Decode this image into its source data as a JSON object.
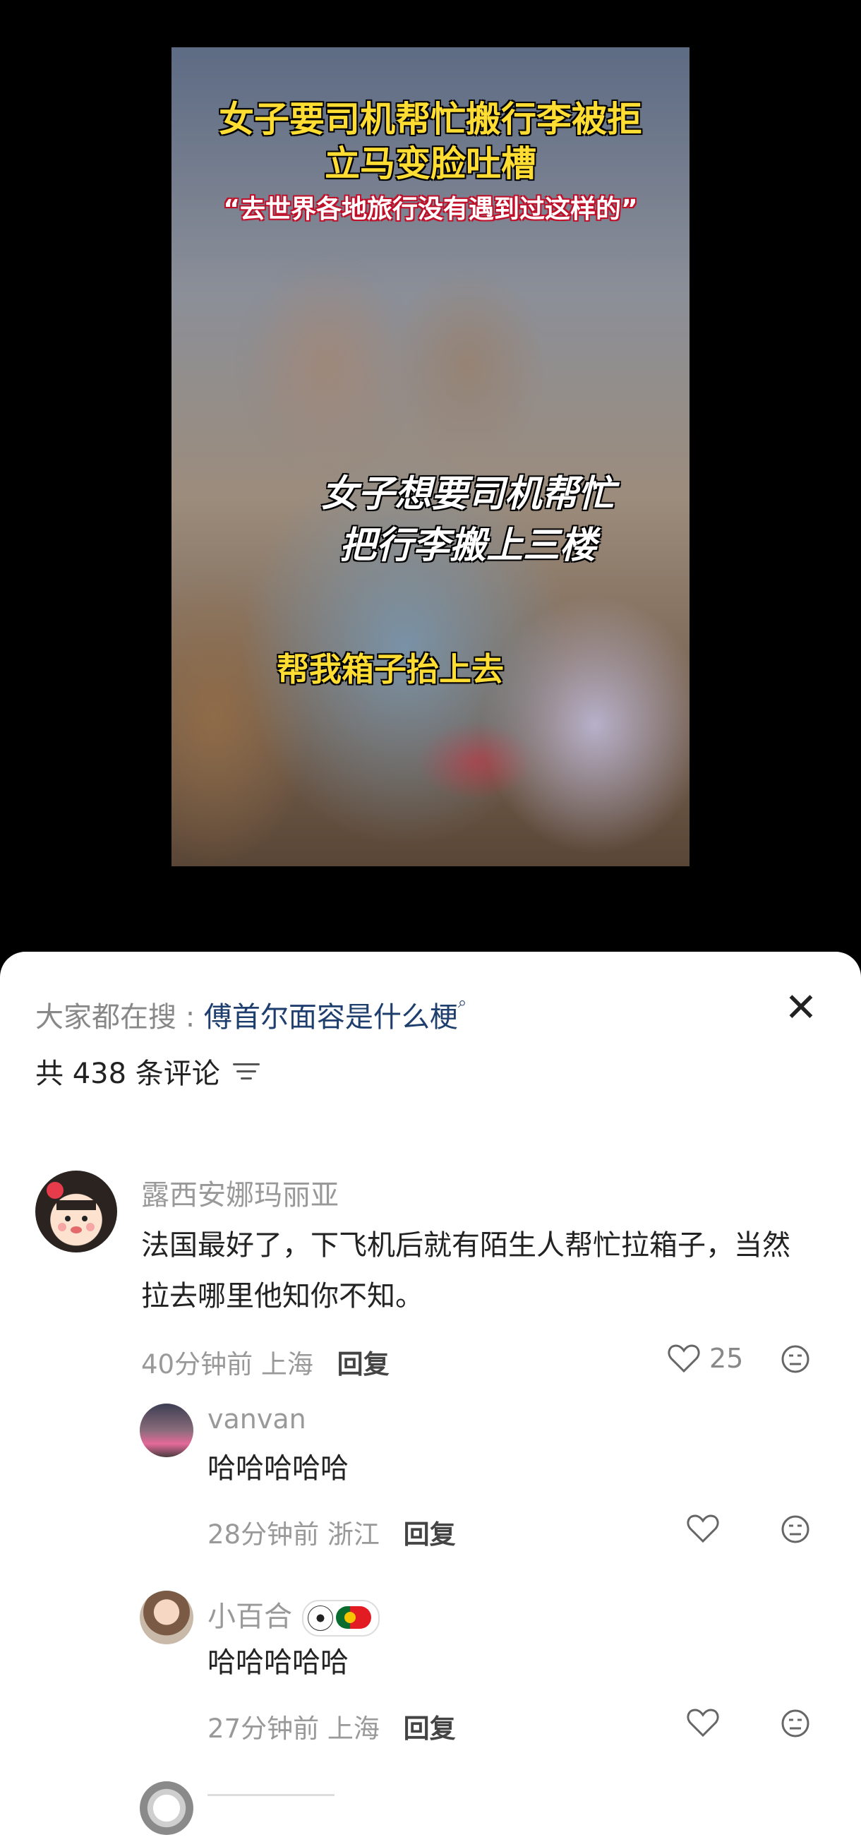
{
  "video": {
    "title_line1": "女子要司机帮忙搬行李被拒",
    "title_line2": "立马变脸吐槽",
    "quote": "“去世界各地旅行没有遇到过这样的”",
    "subtitle_line1": "女子想要司机帮忙",
    "subtitle_line2": "把行李搬上三楼",
    "dialogue": "帮我箱子抬上去"
  },
  "comments_sheet": {
    "search_prefix": "大家都在搜 :",
    "search_term": "傅首尔面容是什么梗",
    "total_label": "共 438 条评论",
    "icons": {
      "close": "close-icon",
      "sort": "filter-icon"
    }
  },
  "comments": [
    {
      "user": "露西安娜玛丽亚",
      "text": "法国最好了，下飞机后就有陌生人帮忙拉箱子，当然拉去哪里他知你不知。",
      "time": "40分钟前",
      "location": "上海",
      "reply_label": "回复",
      "likes": "25"
    },
    {
      "user": "vanvan",
      "text": "哈哈哈哈哈",
      "time": "28分钟前",
      "location": "浙江",
      "reply_label": "回复",
      "likes": ""
    },
    {
      "user": "小百合",
      "text": "哈哈哈哈哈",
      "time": "27分钟前",
      "location": "上海",
      "reply_label": "回复",
      "likes": ""
    }
  ],
  "colors": {
    "accent_link": "#1e3f6e",
    "caption_yellow": "#ffdd33",
    "muted": "#999999"
  }
}
